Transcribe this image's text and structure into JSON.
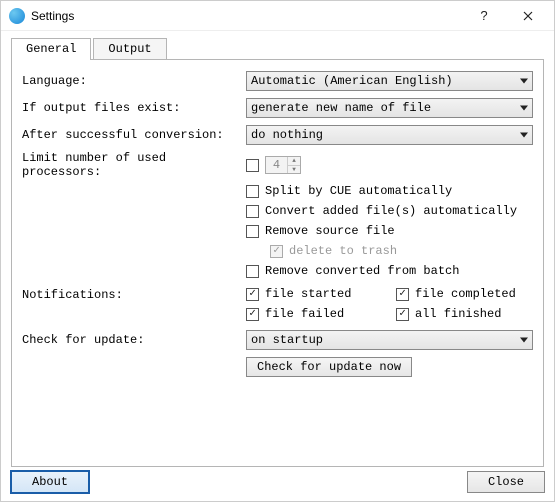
{
  "window": {
    "title": "Settings"
  },
  "tabs": {
    "general": "General",
    "output": "Output"
  },
  "labels": {
    "language": "Language:",
    "ifExist": "If output files exist:",
    "afterConv": "After successful conversion:",
    "limitProc": "Limit number of used processors:",
    "notifications": "Notifications:",
    "checkUpdate": "Check for update:"
  },
  "dropdowns": {
    "language": "Automatic (American English)",
    "ifExist": "generate new name of file",
    "afterConv": "do nothing",
    "checkUpdate": "on startup"
  },
  "spinner": {
    "processors": "4"
  },
  "checkboxes": {
    "splitCue": "Split by CUE automatically",
    "convertAuto": "Convert added file(s) automatically",
    "removeSource": "Remove source file",
    "deleteTrash": "delete to trash",
    "removeConverted": "Remove converted from batch",
    "fileStarted": "file started",
    "fileCompleted": "file completed",
    "fileFailed": "file failed",
    "allFinished": "all finished"
  },
  "buttons": {
    "checkNow": "Check for update now",
    "about": "About",
    "close": "Close"
  }
}
